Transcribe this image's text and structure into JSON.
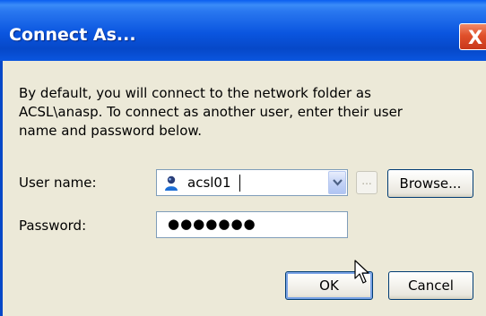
{
  "dialog": {
    "title": "Connect As...",
    "close_glyph": "X",
    "description_lines": [
      "By default, you will connect to the network folder as",
      "ACSL\\anasp. To connect as another user, enter their user",
      "name and password below."
    ]
  },
  "form": {
    "username_label": "User name:",
    "username_value": "acsl01",
    "username_icon": "user-icon",
    "ellipsis_label": "...",
    "browse_label": "Browse...",
    "password_label": "Password:",
    "password_masked": "●●●●●●●"
  },
  "actions": {
    "ok_label": "OK",
    "cancel_label": "Cancel"
  },
  "colors": {
    "titlebar": "#0a55df",
    "close_button": "#e0502a",
    "dialog_background": "#ece9d8",
    "field_border": "#7f9db9"
  }
}
